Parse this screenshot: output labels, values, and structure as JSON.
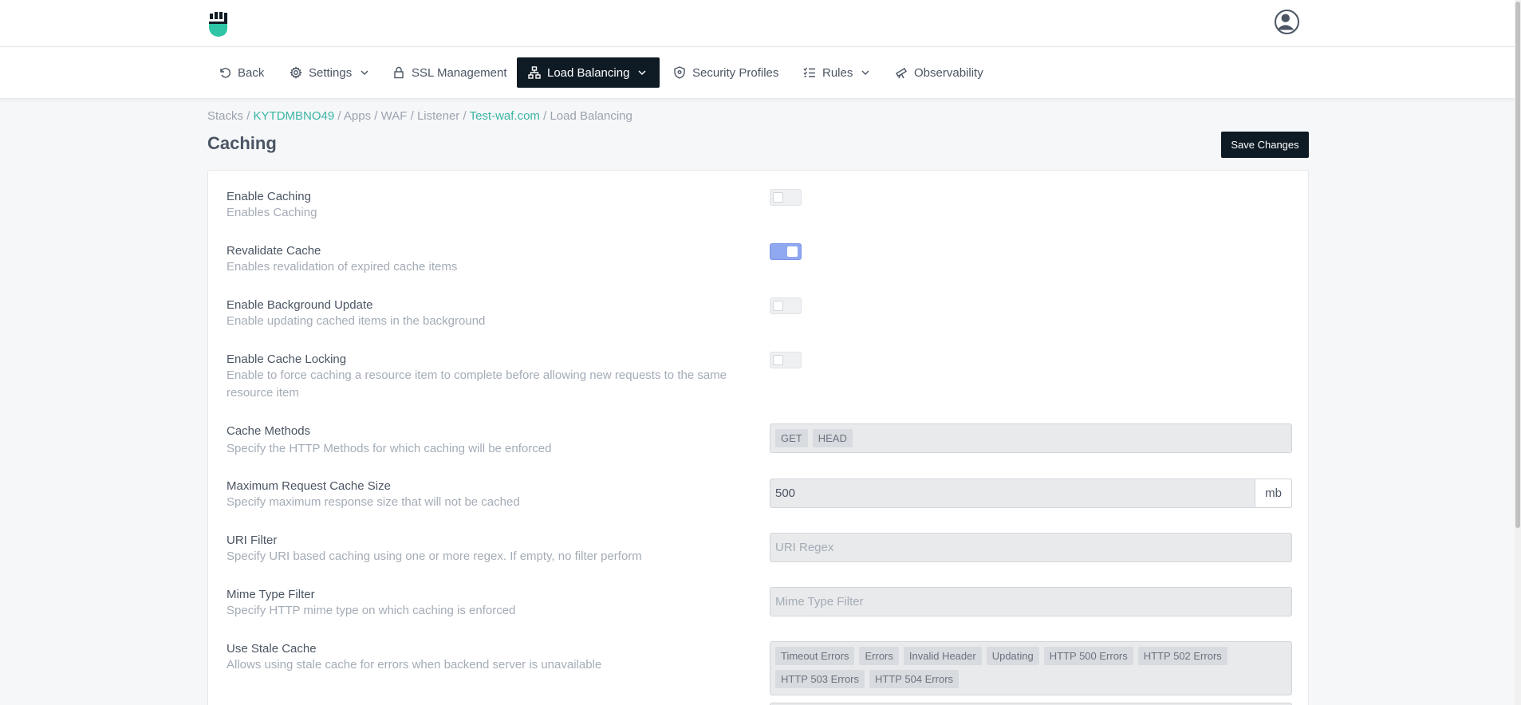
{
  "header": {
    "logo_icon": "fist-shield-logo",
    "avatar_icon": "user-avatar-icon"
  },
  "nav": {
    "items": [
      {
        "label": "Back",
        "icon": "back-arrow-icon"
      },
      {
        "label": "Settings",
        "icon": "gear-icon",
        "dropdown": true
      },
      {
        "label": "SSL Management",
        "icon": "lock-icon"
      },
      {
        "label": "Load Balancing",
        "icon": "network-icon",
        "dropdown": true,
        "active": true
      },
      {
        "label": "Security Profiles",
        "icon": "shield-icon"
      },
      {
        "label": "Rules",
        "icon": "list-check-icon",
        "dropdown": true
      },
      {
        "label": "Observability",
        "icon": "telescope-icon"
      }
    ]
  },
  "breadcrumb": {
    "stacks": "Stacks",
    "stack_id": "KYTDMBNO49",
    "apps": "Apps",
    "waf": "WAF",
    "listener": "Listener",
    "domain": "Test-waf.com",
    "current": "Load Balancing",
    "sep": "/"
  },
  "page": {
    "title": "Caching",
    "save_label": "Save Changes"
  },
  "settings": {
    "enable_caching": {
      "label": "Enable Caching",
      "desc": "Enables Caching",
      "on": false
    },
    "revalidate_cache": {
      "label": "Revalidate Cache",
      "desc": "Enables revalidation of expired cache items",
      "on": true
    },
    "background_update": {
      "label": "Enable Background Update",
      "desc": "Enable updating cached items in the background",
      "on": false
    },
    "cache_locking": {
      "label": "Enable Cache Locking",
      "desc": "Enable to force caching a resource item to complete before allowing new requests to the same resource item",
      "on": false
    },
    "cache_methods": {
      "label": "Cache Methods",
      "desc": "Specify the HTTP Methods for which caching will be enforced",
      "tags": [
        "GET",
        "HEAD"
      ]
    },
    "max_cache_size": {
      "label": "Maximum Request Cache Size",
      "desc": "Specify maximum response size that will not be cached",
      "value": "500",
      "unit": "mb"
    },
    "uri_filter": {
      "label": "URI Filter",
      "desc": "Specify URI based caching using one or more regex. If empty, no filter perform",
      "placeholder": "URI Regex"
    },
    "mime_filter": {
      "label": "Mime Type Filter",
      "desc": "Specify HTTP mime type on which caching is enforced",
      "placeholder": "Mime Type Filter"
    },
    "stale_cache": {
      "label": "Use Stale Cache",
      "desc": "Allows using stale cache for errors when backend server is unavailable",
      "tags": [
        "Timeout Errors",
        "Errors",
        "Invalid Header",
        "Updating",
        "HTTP 500 Errors",
        "HTTP 502 Errors",
        "HTTP 503 Errors",
        "HTTP 504 Errors"
      ]
    }
  }
}
